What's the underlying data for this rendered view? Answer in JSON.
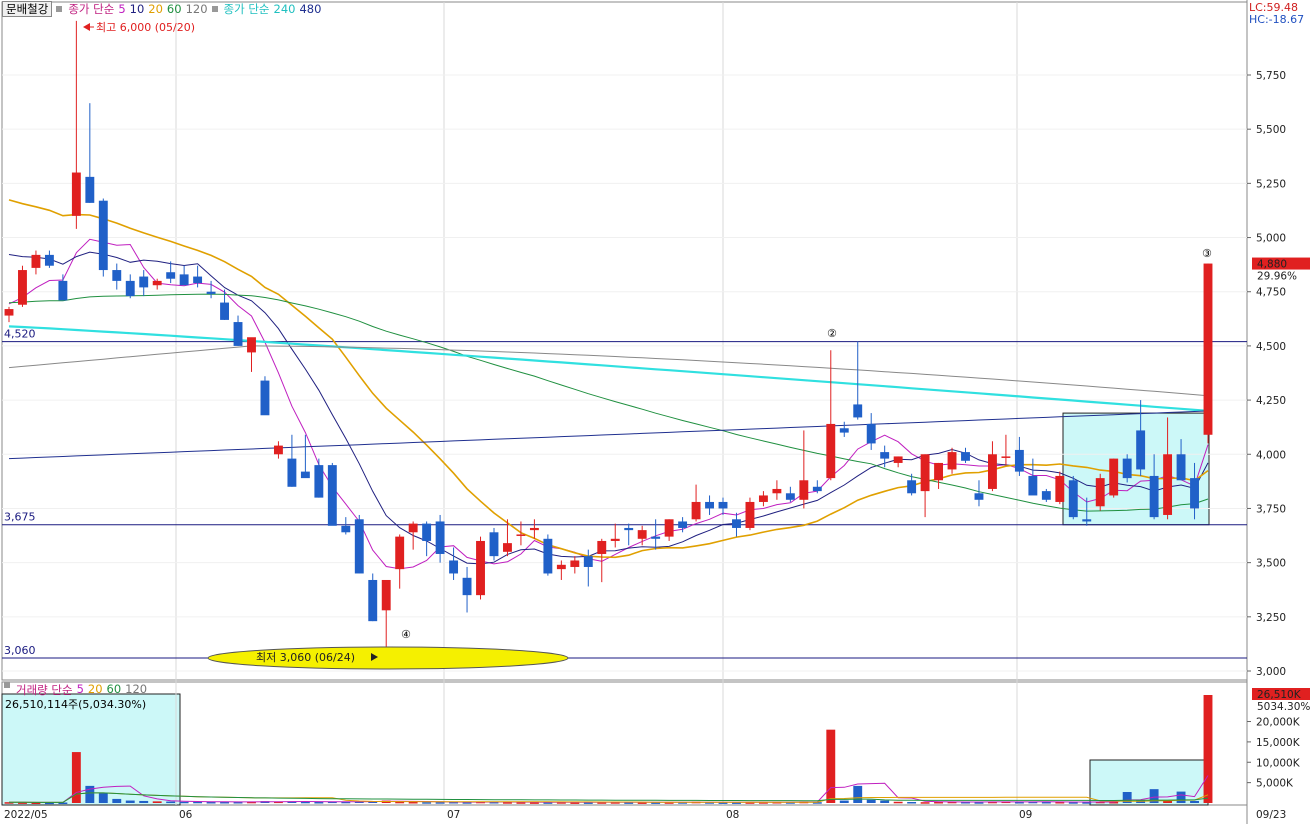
{
  "header": {
    "stock_name": "문배철강",
    "price_ma_label": "종가 단순",
    "price_ma_periods": [
      "5",
      "10",
      "20",
      "60",
      "120"
    ],
    "price_ma_label2": "종가 단순",
    "price_ma_periods2": [
      "240",
      "480"
    ],
    "lc": "LC:59.48",
    "hc": "HC:-18.67"
  },
  "volume_header": {
    "label": "거래량 단순",
    "periods": [
      "5",
      "20",
      "60",
      "120"
    ],
    "info": "26,510,114주(5,034.30%)"
  },
  "colors": {
    "up": "#e02020",
    "down": "#2060c8",
    "ma5": "#c020c0",
    "ma10": "#202080",
    "ma20": "#e0a000",
    "ma60": "#209040",
    "ma120": "#888888",
    "ma240": "#30e0e0",
    "ma480": "#203090",
    "hline": "#1a1a80",
    "box_fill": "#ccf8f8",
    "box_stroke": "#222222",
    "ellipse": "#f5f000"
  },
  "chart_data": [
    {
      "type": "candlestick",
      "title": "",
      "y_axis": {
        "min": 3000,
        "max": 6000,
        "ticks": [
          3000,
          3250,
          3500,
          3750,
          4000,
          4250,
          4500,
          4750,
          5000,
          5250,
          5500,
          5750
        ],
        "tick_labels": [
          "3,000",
          "3,250",
          "3,500",
          "3,750",
          "4,000",
          "4,250",
          "4,500",
          "4,750",
          "5,000",
          "5,250",
          "5,500",
          "5,750"
        ]
      },
      "x_axis": {
        "labels": [
          "2022/05",
          "06",
          "07",
          "08",
          "09",
          "09/23"
        ],
        "label_index": [
          0,
          14,
          36,
          58,
          82,
          100
        ]
      },
      "candles": [
        [
          4640,
          4680,
          4610,
          4670
        ],
        [
          4690,
          4870,
          4680,
          4850
        ],
        [
          4860,
          4940,
          4830,
          4920
        ],
        [
          4920,
          4940,
          4860,
          4870
        ],
        [
          4800,
          4830,
          4740,
          4710
        ],
        [
          5100,
          6000,
          5040,
          5300
        ],
        [
          5280,
          5620,
          5160,
          5160
        ],
        [
          5170,
          5180,
          4820,
          4850
        ],
        [
          4850,
          4880,
          4760,
          4800
        ],
        [
          4800,
          4830,
          4720,
          4730
        ],
        [
          4820,
          4850,
          4730,
          4770
        ],
        [
          4780,
          4810,
          4760,
          4800
        ],
        [
          4840,
          4890,
          4790,
          4810
        ],
        [
          4830,
          4870,
          4790,
          4780
        ],
        [
          4820,
          4870,
          4770,
          4790
        ],
        [
          4750,
          4800,
          4720,
          4740
        ],
        [
          4700,
          4760,
          4620,
          4620
        ],
        [
          4610,
          4640,
          4500,
          4500
        ],
        [
          4470,
          4520,
          4380,
          4540
        ],
        [
          4340,
          4360,
          4200,
          4180
        ],
        [
          4000,
          4060,
          3980,
          4040
        ],
        [
          3980,
          4090,
          3850,
          3850
        ],
        [
          3920,
          4090,
          3910,
          3890
        ],
        [
          3950,
          3980,
          3800,
          3800
        ],
        [
          3950,
          3960,
          3680,
          3670
        ],
        [
          3670,
          3710,
          3630,
          3640
        ],
        [
          3700,
          3720,
          3450,
          3450
        ],
        [
          3420,
          3450,
          3230,
          3230
        ],
        [
          3280,
          3300,
          3060,
          3420
        ],
        [
          3470,
          3630,
          3380,
          3620
        ],
        [
          3640,
          3690,
          3560,
          3680
        ],
        [
          3680,
          3690,
          3530,
          3600
        ],
        [
          3690,
          3720,
          3500,
          3540
        ],
        [
          3510,
          3570,
          3420,
          3450
        ],
        [
          3430,
          3480,
          3270,
          3350
        ],
        [
          3350,
          3620,
          3330,
          3600
        ],
        [
          3640,
          3660,
          3510,
          3530
        ],
        [
          3550,
          3700,
          3530,
          3590
        ],
        [
          3630,
          3690,
          3580,
          3630
        ],
        [
          3650,
          3700,
          3610,
          3660
        ],
        [
          3610,
          3630,
          3440,
          3450
        ],
        [
          3470,
          3510,
          3420,
          3490
        ],
        [
          3480,
          3530,
          3450,
          3510
        ],
        [
          3530,
          3560,
          3390,
          3480
        ],
        [
          3540,
          3610,
          3410,
          3600
        ],
        [
          3600,
          3680,
          3570,
          3610
        ],
        [
          3660,
          3680,
          3580,
          3650
        ],
        [
          3610,
          3670,
          3580,
          3650
        ],
        [
          3620,
          3700,
          3560,
          3610
        ],
        [
          3620,
          3700,
          3600,
          3700
        ],
        [
          3690,
          3710,
          3640,
          3660
        ],
        [
          3700,
          3860,
          3690,
          3780
        ],
        [
          3780,
          3810,
          3720,
          3750
        ],
        [
          3780,
          3800,
          3720,
          3750
        ],
        [
          3700,
          3730,
          3620,
          3660
        ],
        [
          3660,
          3800,
          3650,
          3780
        ],
        [
          3780,
          3830,
          3760,
          3810
        ],
        [
          3820,
          3880,
          3790,
          3840
        ],
        [
          3820,
          3850,
          3780,
          3790
        ],
        [
          3790,
          4110,
          3750,
          3880
        ],
        [
          3850,
          3880,
          3820,
          3830
        ],
        [
          3890,
          4480,
          3880,
          4140
        ],
        [
          4120,
          4150,
          4080,
          4100
        ],
        [
          4230,
          4520,
          4160,
          4170
        ],
        [
          4140,
          4190,
          4020,
          4050
        ],
        [
          4010,
          4040,
          3940,
          3980
        ],
        [
          3960,
          3990,
          3940,
          3990
        ],
        [
          3880,
          3910,
          3810,
          3820
        ],
        [
          3830,
          4000,
          3710,
          4000
        ],
        [
          3880,
          3960,
          3840,
          3960
        ],
        [
          3930,
          4030,
          3910,
          4010
        ],
        [
          4010,
          4030,
          3960,
          3970
        ],
        [
          3820,
          3880,
          3760,
          3790
        ],
        [
          3840,
          4060,
          3830,
          4000
        ],
        [
          3990,
          4090,
          3950,
          3990
        ],
        [
          4020,
          4080,
          3900,
          3920
        ],
        [
          3900,
          3980,
          3840,
          3810
        ],
        [
          3830,
          3840,
          3780,
          3790
        ],
        [
          3780,
          3920,
          3770,
          3900
        ],
        [
          3880,
          3900,
          3700,
          3710
        ],
        [
          3700,
          3800,
          3670,
          3690
        ],
        [
          3760,
          3910,
          3740,
          3890
        ],
        [
          3810,
          3980,
          3800,
          3980
        ],
        [
          3980,
          4000,
          3870,
          3890
        ],
        [
          4110,
          4250,
          3900,
          3930
        ],
        [
          3900,
          4000,
          3700,
          3710
        ],
        [
          3720,
          4170,
          3700,
          4000
        ],
        [
          4000,
          4070,
          3880,
          3880
        ],
        [
          3890,
          3960,
          3700,
          3750
        ],
        [
          4090,
          4880,
          4050,
          4880
        ]
      ],
      "horizontal_lines": [
        {
          "value": 4520,
          "label": "4,520"
        },
        {
          "value": 3675,
          "label": "3,675"
        },
        {
          "value": 3060,
          "label": "3,060"
        }
      ],
      "annotations": {
        "high": "최고 6,000 (05/20)",
        "low": "최저 3,060 (06/24)",
        "marker_2": "②",
        "marker_3": "③",
        "marker_4": "④"
      },
      "current_price": {
        "value": 4880,
        "label": "4,880",
        "change": "29.96%"
      }
    },
    {
      "type": "bar",
      "title": "",
      "series_name": "거래량",
      "y_axis": {
        "min": 0,
        "max": 26510,
        "unit": "K",
        "ticks": [
          5000,
          10000,
          15000,
          20000
        ],
        "tick_labels": [
          "5,000K",
          "10,000K",
          "15,000K",
          "20,000K"
        ]
      },
      "values_k": [
        200,
        150,
        120,
        100,
        120,
        12500,
        4200,
        2500,
        1000,
        600,
        500,
        400,
        350,
        300,
        300,
        250,
        250,
        250,
        300,
        450,
        350,
        400,
        300,
        250,
        350,
        300,
        400,
        450,
        600,
        300,
        250,
        200,
        200,
        250,
        200,
        300,
        250,
        200,
        180,
        160,
        170,
        200,
        150,
        150,
        180,
        200,
        160,
        150,
        150,
        180,
        200,
        300,
        200,
        150,
        150,
        180,
        200,
        250,
        200,
        300,
        200,
        18000,
        600,
        4200,
        800,
        600,
        300,
        250,
        200,
        250,
        300,
        250,
        200,
        300,
        350,
        250,
        300,
        250,
        250,
        200,
        200,
        300,
        250,
        2700,
        600,
        3400,
        500,
        2800,
        500,
        26510
      ],
      "current": {
        "label": "26,510K",
        "change": "5034.30%"
      }
    }
  ]
}
